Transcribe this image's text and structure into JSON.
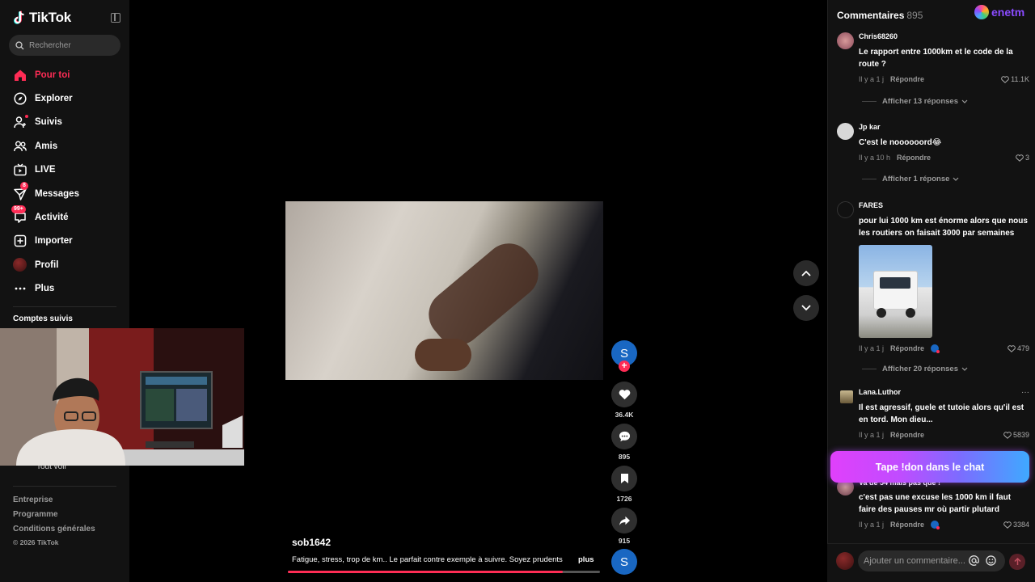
{
  "app": {
    "brand": "TikTok"
  },
  "search": {
    "placeholder": "Rechercher"
  },
  "nav": {
    "items": [
      {
        "label": "Pour toi",
        "icon": "home-icon",
        "active": true
      },
      {
        "label": "Explorer",
        "icon": "compass-icon"
      },
      {
        "label": "Suivis",
        "icon": "following-icon"
      },
      {
        "label": "Amis",
        "icon": "friends-icon"
      },
      {
        "label": "LIVE",
        "icon": "live-icon"
      },
      {
        "label": "Messages",
        "icon": "messages-icon",
        "badge": "8"
      },
      {
        "label": "Activité",
        "icon": "activity-icon",
        "badge": "99+"
      },
      {
        "label": "Importer",
        "icon": "upload-icon"
      },
      {
        "label": "Profil",
        "icon": "profile-avatar"
      },
      {
        "label": "Plus",
        "icon": "more-icon"
      }
    ]
  },
  "sidebar": {
    "following_title": "Comptes suivis",
    "see_all": "Tout voir",
    "footer": [
      "Entreprise",
      "Programme",
      "Conditions générales"
    ],
    "copyright": "© 2026 TikTok"
  },
  "video": {
    "author": "sob1642",
    "description": "Fatigue, stress, trop de km.. Le parfait contre exemple à suivre. Soyez prudents",
    "more_label": "plus",
    "progress": 0.88
  },
  "actions": {
    "creator_initial": "S",
    "likes": "36.4K",
    "comments": "895",
    "saves": "1726",
    "shares": "915"
  },
  "comments_panel": {
    "title": "Commentaires",
    "count": "895",
    "brand": "enetm",
    "promo": "Tape !don dans le chat",
    "input_placeholder": "Ajouter un commentaire...",
    "comments": [
      {
        "user": "Chris68260",
        "text": "Le rapport entre 1000km et le code de la route ?",
        "time": "Il y a 1 j",
        "reply": "Répondre",
        "likes": "11.1K",
        "replies": "Afficher 13 réponses"
      },
      {
        "user": "Jp kar",
        "text": "C'est le noooooord😂",
        "time": "Il y a 10 h",
        "reply": "Répondre",
        "likes": "3",
        "replies": "Afficher 1 réponse"
      },
      {
        "user": "FARES",
        "text": "pour lui 1000 km est énorme alors que nous les routiers on faisait 3000 par semaines",
        "time": "Il y a 1 j",
        "reply": "Répondre",
        "likes": "479",
        "replies": "Afficher 20 réponses"
      },
      {
        "user": "Lana.Luthor",
        "text": "Il est agressif, guele et tutoie alors qu'il est en tord. Mon dieu...",
        "time": "Il y a 1 j",
        "reply": "Répondre",
        "likes": "5839"
      },
      {
        "user": "Va de 54 mais pas que !",
        "text": "c'est pas une excuse les 1000 km il faut faire des pauses mr où partir plutard",
        "time": "Il y a 1 j",
        "reply": "Répondre",
        "likes": "3384"
      }
    ]
  },
  "colors": {
    "accent": "#fe2c55",
    "background": "#000000",
    "panel": "#121212"
  }
}
